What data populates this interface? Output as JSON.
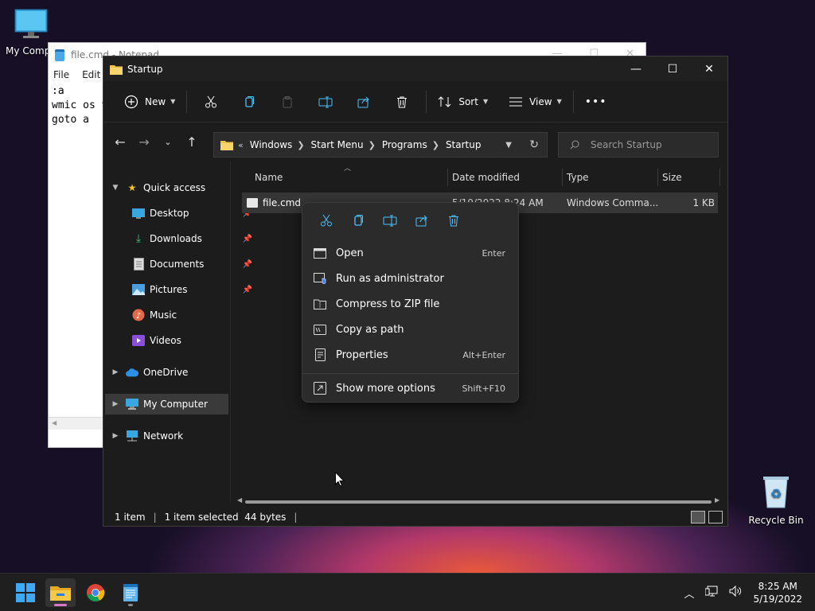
{
  "desktop": {
    "icons": [
      {
        "label": "My Compu"
      },
      {
        "label": "Recycle Bin"
      }
    ]
  },
  "notepad": {
    "title": "file.cmd - Notepad",
    "menu": [
      "File",
      "Edit"
    ],
    "lines": [
      ":a",
      "wmic os v",
      "goto a"
    ]
  },
  "explorer": {
    "title": "Startup",
    "toolbar": {
      "new_label": "New",
      "sort_label": "Sort",
      "view_label": "View",
      "more_label": "•••"
    },
    "address": {
      "overflow": "«",
      "crumbs": [
        "Windows",
        "Start Menu",
        "Programs",
        "Startup"
      ]
    },
    "search_placeholder": "Search Startup",
    "nav": {
      "quick_access": "Quick access",
      "items": [
        "Desktop",
        "Downloads",
        "Documents",
        "Pictures",
        "Music",
        "Videos"
      ],
      "onedrive": "OneDrive",
      "my_computer": "My Computer",
      "network": "Network"
    },
    "columns": [
      "Name",
      "Date modified",
      "Type",
      "Size"
    ],
    "files": [
      {
        "name": "file.cmd",
        "date": "5/19/2022 8:24 AM",
        "type": "Windows Comma...",
        "size": "1 KB"
      }
    ],
    "status": {
      "count": "1 item",
      "selected": "1 item selected  44 bytes"
    }
  },
  "context_menu": {
    "items": [
      {
        "label": "Open",
        "shortcut": "Enter"
      },
      {
        "label": "Run as administrator",
        "shortcut": ""
      },
      {
        "label": "Compress to ZIP file",
        "shortcut": ""
      },
      {
        "label": "Copy as path",
        "shortcut": ""
      },
      {
        "label": "Properties",
        "shortcut": "Alt+Enter"
      },
      {
        "label": "Show more options",
        "shortcut": "Shift+F10"
      }
    ]
  },
  "taskbar": {
    "time": "8:25 AM",
    "date": "5/19/2022"
  },
  "colors": {
    "accent": "#4cc2ff",
    "folder": "#f0c24c",
    "star": "#f5c518"
  }
}
